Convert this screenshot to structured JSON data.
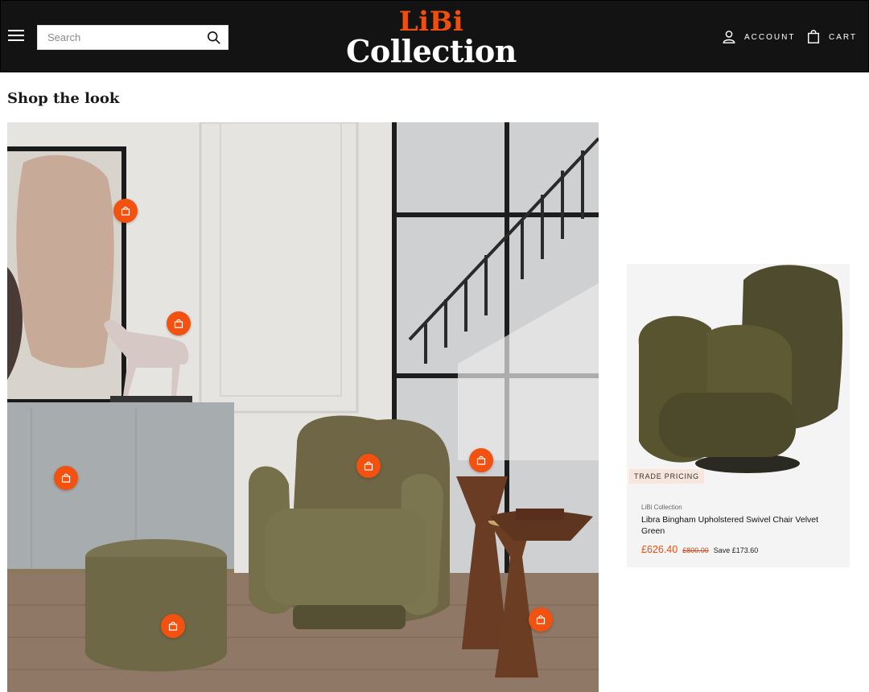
{
  "header": {
    "search_placeholder": "Search",
    "logo_top": "LiBi",
    "logo_bottom": "Collection",
    "account_label": "ACCOUNT",
    "cart_label": "CART"
  },
  "colors": {
    "header_bg": "#131313",
    "accent": "#f04e0c",
    "hotspot": "#f2510f"
  },
  "main": {
    "section_title": "Shop the look"
  },
  "product": {
    "badge": "TRADE PRICING",
    "vendor": "LiBi Collection",
    "name": "Libra Bingham Upholstered Swivel Chair Velvet Green",
    "price": "£626.40",
    "compare_price": "£800.00",
    "savings": "Save £173.60"
  }
}
